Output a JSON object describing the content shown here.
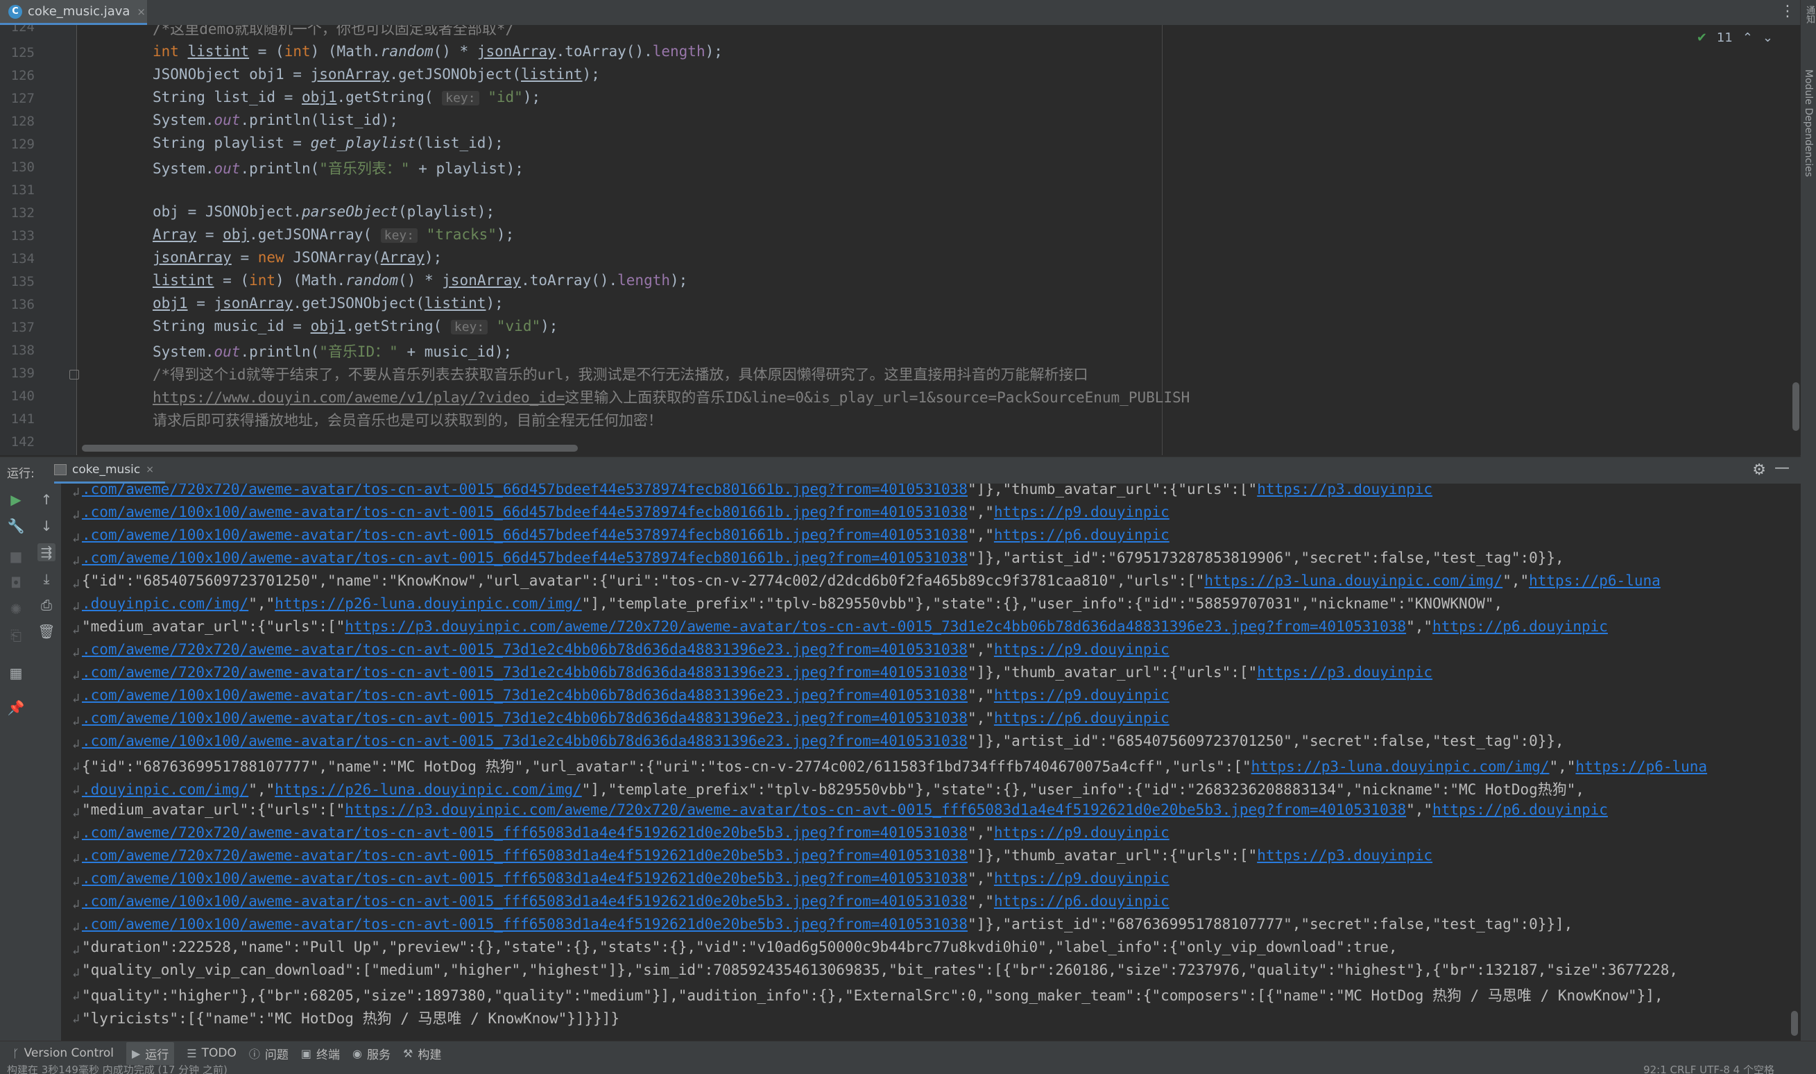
{
  "editor_tab": {
    "file_name": "coke_music.java",
    "close": "×"
  },
  "editor": {
    "menu_icon": "⋮",
    "inspection": {
      "check": "✔",
      "count": "11",
      "up": "⌃",
      "down": "⌄"
    },
    "line_numbers": [
      "124",
      "125",
      "126",
      "127",
      "128",
      "129",
      "130",
      "131",
      "132",
      "133",
      "134",
      "135",
      "136",
      "137",
      "138",
      "139",
      "140",
      "141",
      "142"
    ],
    "comment_top": "/*这里demo就取随机一个，你也可以固定或者全部取*/",
    "key_hint": "key:",
    "str_id": "\"id\"",
    "str_music_list": "\"音乐列表：\"",
    "str_tracks": "\"tracks\"",
    "str_vid": "\"vid\"",
    "str_music_id": "\"音乐ID：\"",
    "comment_139": "/*得到这个id就等于结束了，不要从音乐列表去获取音乐的url，我测试是不行无法播放，具体原因懒得研究了。这里直接用抖音的万能解析接口",
    "comment_140_url": "https://www.douyin.com/aweme/v1/play/?video_id=",
    "comment_140_rest": "这里输入上面获取的音乐ID&line=0&is_play_url=1&source=PackSourceEnum_PUBLISH",
    "comment_141": "请求后即可获得播放地址，会员音乐也是可以获取到的，目前全程无任何加密！"
  },
  "right_strip": {
    "top_label": "通知",
    "label": "Module Dependencies"
  },
  "run_panel": {
    "label": "运行:",
    "tab_name": "coke_music",
    "tab_close": "×",
    "settings_icon": "⚙",
    "minimize_icon": "—",
    "wrap_glyph": "↲"
  },
  "console": {
    "lines": [
      {
        "segs": [
          {
            "t": ".com/aweme/720x720/aweme-avatar/tos-cn-avt-0015_66d457bdeef44e5378974fecb801661b.jpeg?from=4010531038",
            "l": true
          },
          {
            "t": "\"]},\"thumb_avatar_url\":{\"urls\":[\""
          },
          {
            "t": "https://p3.douyinpic",
            "l": true
          }
        ],
        "w": true
      },
      {
        "segs": [
          {
            "t": ".com/aweme/100x100/aweme-avatar/tos-cn-avt-0015_66d457bdeef44e5378974fecb801661b.jpeg?from=4010531038",
            "l": true
          },
          {
            "t": "\",\""
          },
          {
            "t": "https://p9.douyinpic",
            "l": true
          }
        ],
        "w": true
      },
      {
        "segs": [
          {
            "t": ".com/aweme/100x100/aweme-avatar/tos-cn-avt-0015_66d457bdeef44e5378974fecb801661b.jpeg?from=4010531038",
            "l": true
          },
          {
            "t": "\",\""
          },
          {
            "t": "https://p6.douyinpic",
            "l": true
          }
        ],
        "w": true
      },
      {
        "segs": [
          {
            "t": ".com/aweme/100x100/aweme-avatar/tos-cn-avt-0015_66d457bdeef44e5378974fecb801661b.jpeg?from=4010531038",
            "l": true
          },
          {
            "t": "\"]},\"artist_id\":\"6795173287853819906\",\"secret\":false,\"test_tag\":0}},"
          }
        ],
        "w": true
      },
      {
        "segs": [
          {
            "t": "{\"id\":\"6854075609723701250\",\"name\":\"KnowKnow\",\"url_avatar\":{\"uri\":\"tos-cn-v-2774c002/d2dcd6b0f2fa465b89cc9f3781caa810\",\"urls\":[\""
          },
          {
            "t": "https://p3-luna.douyinpic.com/img/",
            "l": true
          },
          {
            "t": "\",\""
          },
          {
            "t": "https://p6-luna",
            "l": true
          }
        ],
        "w": true
      },
      {
        "segs": [
          {
            "t": ".douyinpic.com/img/",
            "l": true
          },
          {
            "t": "\",\""
          },
          {
            "t": "https://p26-luna.douyinpic.com/img/",
            "l": true
          },
          {
            "t": "\"],\"template_prefix\":\"tplv-b829550vbb\"},\"state\":{},\"user_info\":{\"id\":\"58859707031\",\"nickname\":\"KNOWKNOW\","
          }
        ],
        "w": true
      },
      {
        "segs": [
          {
            "t": "\"medium_avatar_url\":{\"urls\":[\""
          },
          {
            "t": "https://p3.douyinpic.com/aweme/720x720/aweme-avatar/tos-cn-avt-0015_73d1e2c4bb06b78d636da48831396e23.jpeg?from=4010531038",
            "l": true
          },
          {
            "t": "\",\""
          },
          {
            "t": "https://p6.douyinpic",
            "l": true
          }
        ],
        "w": true
      },
      {
        "segs": [
          {
            "t": ".com/aweme/720x720/aweme-avatar/tos-cn-avt-0015_73d1e2c4bb06b78d636da48831396e23.jpeg?from=4010531038",
            "l": true
          },
          {
            "t": "\",\""
          },
          {
            "t": "https://p9.douyinpic",
            "l": true
          }
        ],
        "w": true
      },
      {
        "segs": [
          {
            "t": ".com/aweme/720x720/aweme-avatar/tos-cn-avt-0015_73d1e2c4bb06b78d636da48831396e23.jpeg?from=4010531038",
            "l": true
          },
          {
            "t": "\"]},\"thumb_avatar_url\":{\"urls\":[\""
          },
          {
            "t": "https://p3.douyinpic",
            "l": true
          }
        ],
        "w": true
      },
      {
        "segs": [
          {
            "t": ".com/aweme/100x100/aweme-avatar/tos-cn-avt-0015_73d1e2c4bb06b78d636da48831396e23.jpeg?from=4010531038",
            "l": true
          },
          {
            "t": "\",\""
          },
          {
            "t": "https://p9.douyinpic",
            "l": true
          }
        ],
        "w": true
      },
      {
        "segs": [
          {
            "t": ".com/aweme/100x100/aweme-avatar/tos-cn-avt-0015_73d1e2c4bb06b78d636da48831396e23.jpeg?from=4010531038",
            "l": true
          },
          {
            "t": "\",\""
          },
          {
            "t": "https://p6.douyinpic",
            "l": true
          }
        ],
        "w": true
      },
      {
        "segs": [
          {
            "t": ".com/aweme/100x100/aweme-avatar/tos-cn-avt-0015_73d1e2c4bb06b78d636da48831396e23.jpeg?from=4010531038",
            "l": true
          },
          {
            "t": "\"]},\"artist_id\":\"6854075609723701250\",\"secret\":false,\"test_tag\":0}},"
          }
        ],
        "w": true
      },
      {
        "segs": [
          {
            "t": "{\"id\":\"6876369951788107777\",\"name\":\"MC HotDog 热狗\",\"url_avatar\":{\"uri\":\"tos-cn-v-2774c002/611583f1bd734fffb7404670075a4cff\",\"urls\":[\""
          },
          {
            "t": "https://p3-luna.douyinpic.com/img/",
            "l": true
          },
          {
            "t": "\",\""
          },
          {
            "t": "https://p6-luna",
            "l": true
          }
        ],
        "w": true
      },
      {
        "segs": [
          {
            "t": ".douyinpic.com/img/",
            "l": true
          },
          {
            "t": "\",\""
          },
          {
            "t": "https://p26-luna.douyinpic.com/img/",
            "l": true
          },
          {
            "t": "\"],\"template_prefix\":\"tplv-b829550vbb\"},\"state\":{},\"user_info\":{\"id\":\"2683236208883134\",\"nickname\":\"MC HotDog热狗\","
          }
        ],
        "w": true
      },
      {
        "segs": [
          {
            "t": "\"medium_avatar_url\":{\"urls\":[\""
          },
          {
            "t": "https://p3.douyinpic.com/aweme/720x720/aweme-avatar/tos-cn-avt-0015_fff65083d1a4e4f5192621d0e20be5b3.jpeg?from=4010531038",
            "l": true
          },
          {
            "t": "\",\""
          },
          {
            "t": "https://p6.douyinpic",
            "l": true
          }
        ],
        "w": true
      },
      {
        "segs": [
          {
            "t": ".com/aweme/720x720/aweme-avatar/tos-cn-avt-0015_fff65083d1a4e4f5192621d0e20be5b3.jpeg?from=4010531038",
            "l": true
          },
          {
            "t": "\",\""
          },
          {
            "t": "https://p9.douyinpic",
            "l": true
          }
        ],
        "w": true
      },
      {
        "segs": [
          {
            "t": ".com/aweme/720x720/aweme-avatar/tos-cn-avt-0015_fff65083d1a4e4f5192621d0e20be5b3.jpeg?from=4010531038",
            "l": true
          },
          {
            "t": "\"]},\"thumb_avatar_url\":{\"urls\":[\""
          },
          {
            "t": "https://p3.douyinpic",
            "l": true
          }
        ],
        "w": true
      },
      {
        "segs": [
          {
            "t": ".com/aweme/100x100/aweme-avatar/tos-cn-avt-0015_fff65083d1a4e4f5192621d0e20be5b3.jpeg?from=4010531038",
            "l": true
          },
          {
            "t": "\",\""
          },
          {
            "t": "https://p9.douyinpic",
            "l": true
          }
        ],
        "w": true
      },
      {
        "segs": [
          {
            "t": ".com/aweme/100x100/aweme-avatar/tos-cn-avt-0015_fff65083d1a4e4f5192621d0e20be5b3.jpeg?from=4010531038",
            "l": true
          },
          {
            "t": "\",\""
          },
          {
            "t": "https://p6.douyinpic",
            "l": true
          }
        ],
        "w": true
      },
      {
        "segs": [
          {
            "t": ".com/aweme/100x100/aweme-avatar/tos-cn-avt-0015_fff65083d1a4e4f5192621d0e20be5b3.jpeg?from=4010531038",
            "l": true
          },
          {
            "t": "\"]},\"artist_id\":\"6876369951788107777\",\"secret\":false,\"test_tag\":0}}],"
          }
        ],
        "w": true
      },
      {
        "segs": [
          {
            "t": "\"duration\":222528,\"name\":\"Pull Up\",\"preview\":{},\"state\":{},\"stats\":{},\"vid\":\"v10ad6g50000c9b44brc77u8kvdi0hi0\",\"label_info\":{\"only_vip_download\":true,"
          }
        ],
        "w": true
      },
      {
        "segs": [
          {
            "t": "\"quality_only_vip_can_download\":[\"medium\",\"higher\",\"highest\"]},\"sim_id\":7085924354613069835,\"bit_rates\":[{\"br\":260186,\"size\":7237976,\"quality\":\"highest\"},{\"br\":132187,\"size\":3677228,"
          }
        ],
        "w": true
      },
      {
        "segs": [
          {
            "t": "\"quality\":\"higher\"},{\"br\":68205,\"size\":1897380,\"quality\":\"medium\"}],\"audition_info\":{},\"ExternalSrc\":0,\"song_maker_team\":{\"composers\":[{\"name\":\"MC HotDog 热狗 / 马思唯 / KnowKnow\"}],"
          }
        ],
        "w": true
      },
      {
        "segs": [
          {
            "t": "\"lyricists\":[{\"name\":\"MC HotDog 热狗 / 马思唯 / KnowKnow\"}]}}]}"
          }
        ],
        "w": true
      }
    ]
  },
  "bottom_bar": {
    "items": [
      {
        "icon": "ᚴ",
        "label": "Version Control"
      },
      {
        "icon": "▶",
        "label": "运行"
      },
      {
        "icon": "☰",
        "label": "TODO"
      },
      {
        "icon": "ⓘ",
        "label": "问题"
      },
      {
        "icon": "▣",
        "label": "终端"
      },
      {
        "icon": "◉",
        "label": "服务"
      },
      {
        "icon": "⚒",
        "label": "构建"
      }
    ]
  },
  "status_bar": {
    "left": "构建在 3秒149毫秒 内成功完成 (17 分钟 之前)",
    "right": "92:1   CRLF   UTF-8   4 个空格"
  }
}
